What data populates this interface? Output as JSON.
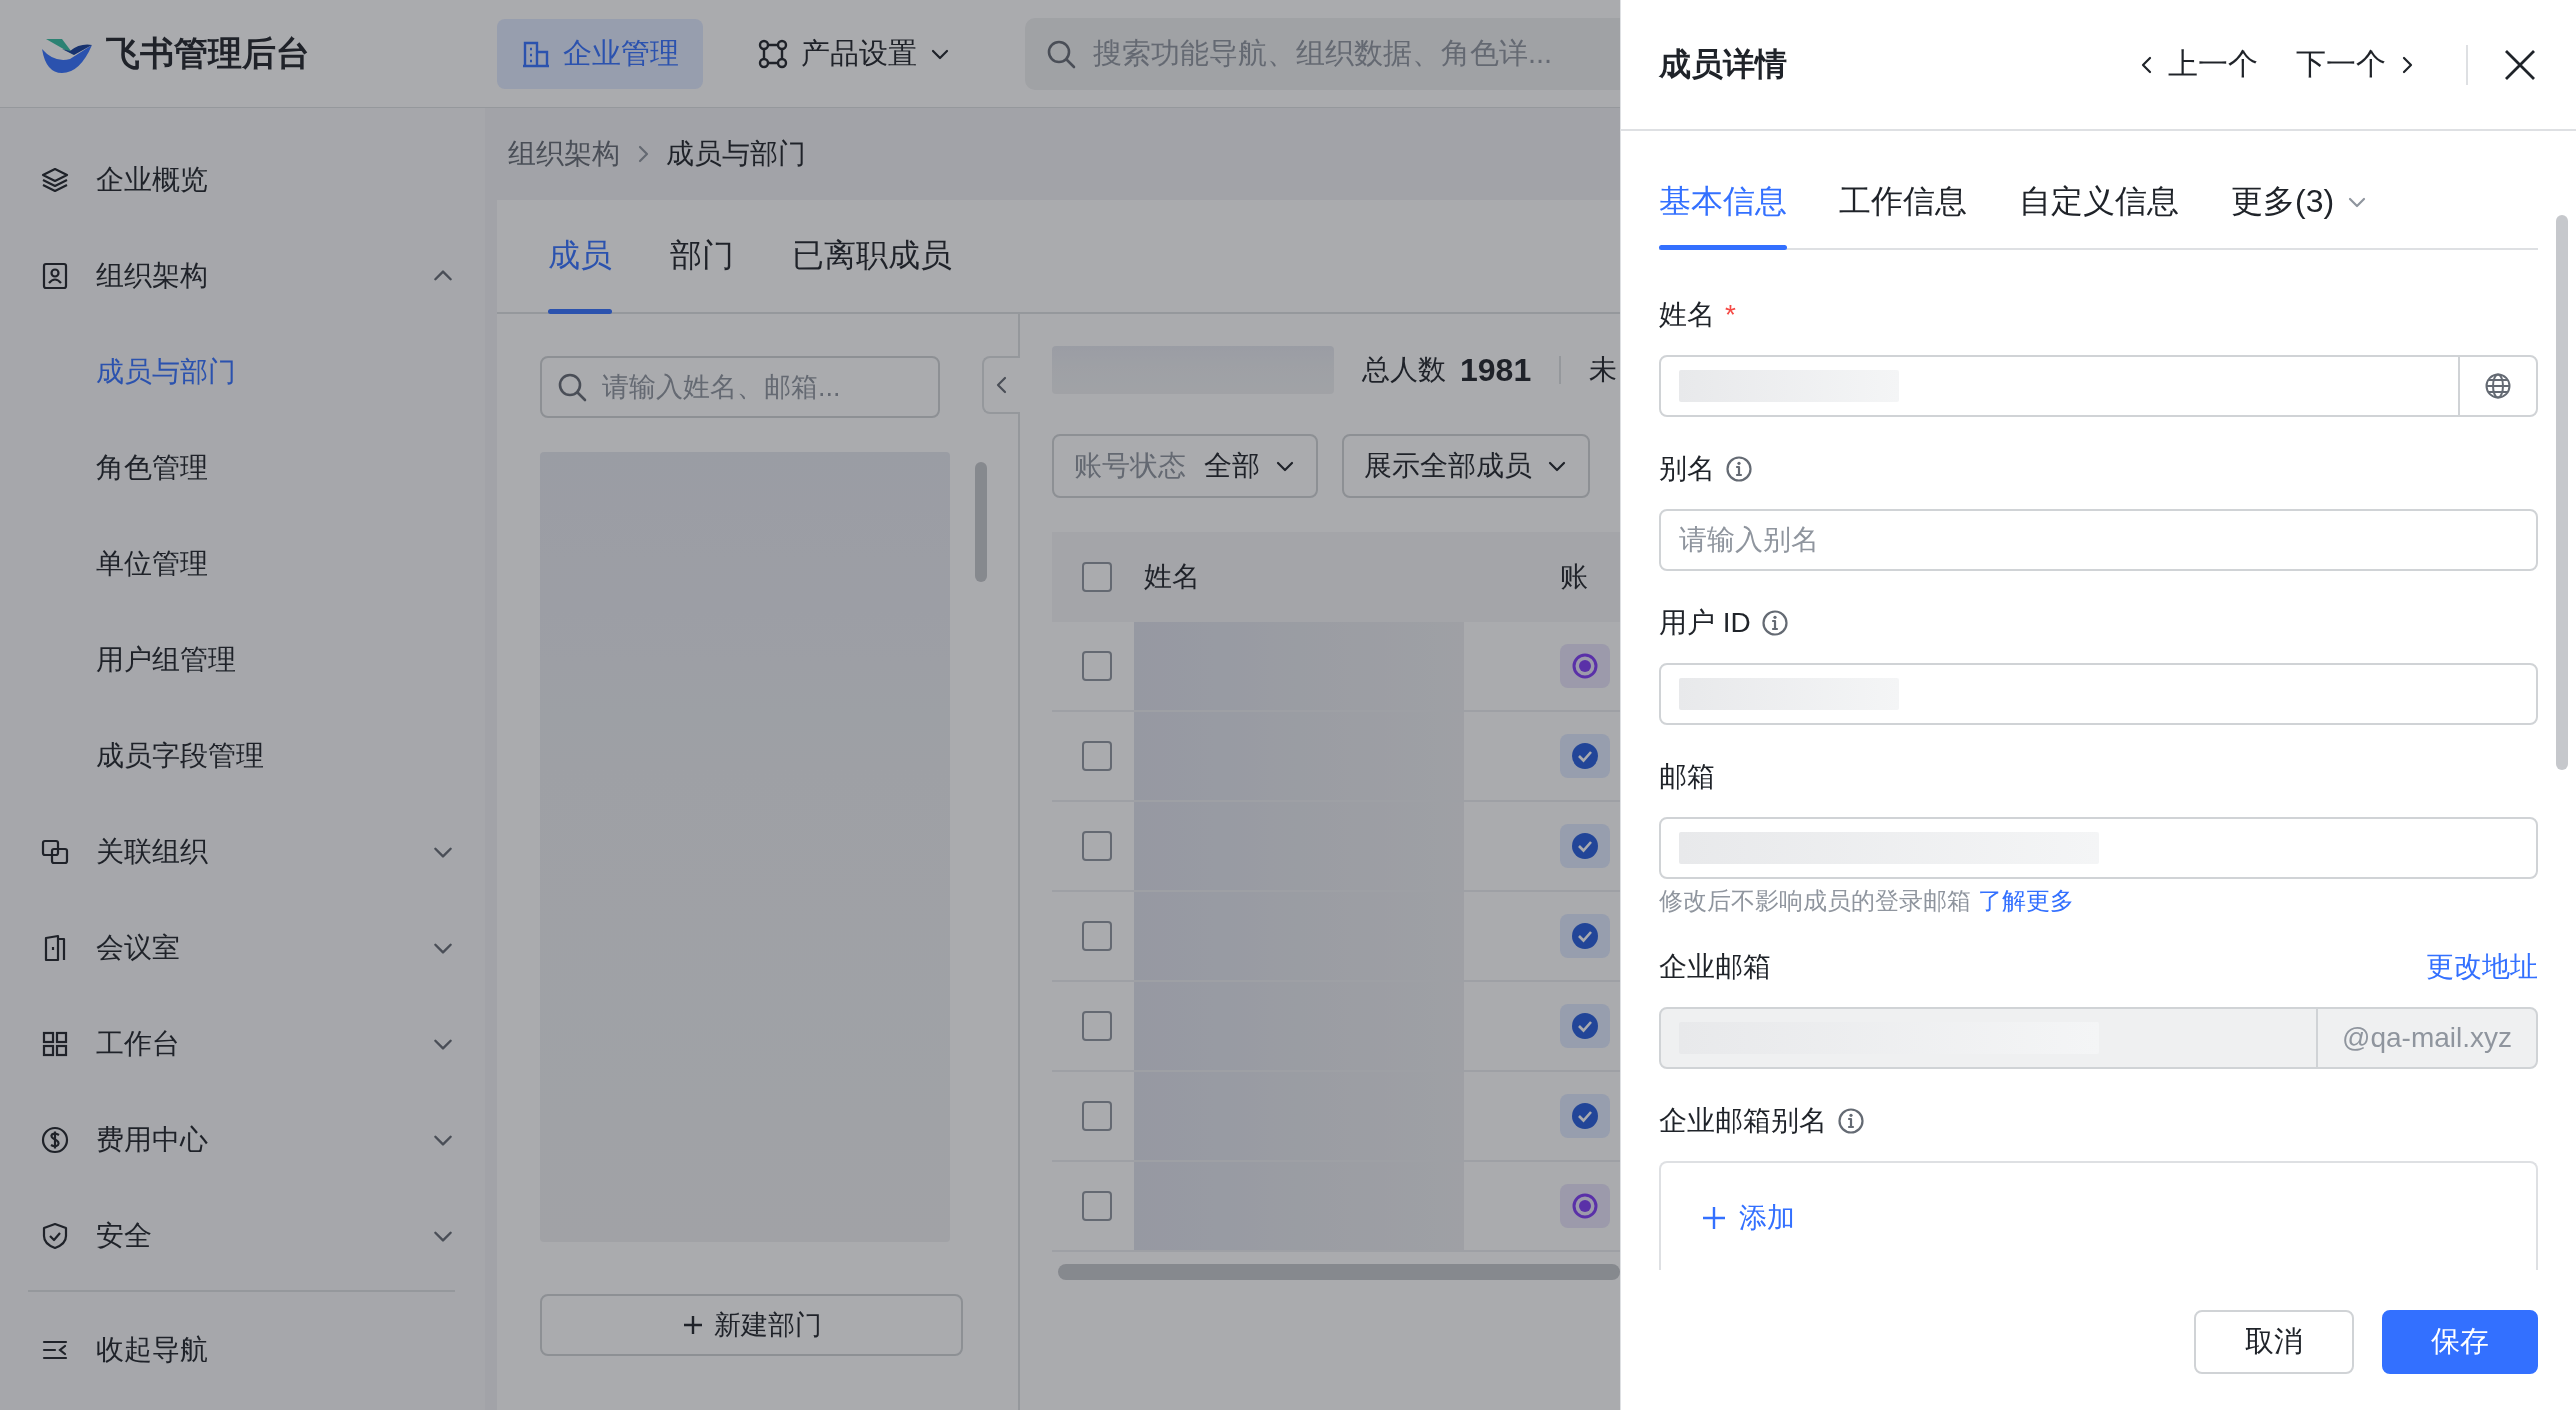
{
  "header": {
    "brand": "飞书管理后台",
    "nav": [
      {
        "label": "企业管理",
        "selected": true
      },
      {
        "label": "产品设置",
        "selected": false,
        "dropdown": true
      }
    ],
    "search": {
      "placeholder": "搜索功能导航、组织数据、角色详..."
    }
  },
  "sidebar": {
    "items": [
      {
        "kind": "link",
        "label": "企业概览",
        "selected": false
      },
      {
        "kind": "group",
        "label": "组织架构",
        "expanded": true,
        "children": [
          {
            "label": "成员与部门",
            "selected": true
          },
          {
            "label": "角色管理",
            "selected": false
          },
          {
            "label": "单位管理",
            "selected": false
          },
          {
            "label": "用户组管理",
            "selected": false
          },
          {
            "label": "成员字段管理",
            "selected": false
          }
        ]
      },
      {
        "kind": "group",
        "label": "关联组织",
        "expanded": false
      },
      {
        "kind": "group",
        "label": "会议室",
        "expanded": false
      },
      {
        "kind": "group",
        "label": "工作台",
        "expanded": false
      },
      {
        "kind": "group",
        "label": "费用中心",
        "expanded": false
      },
      {
        "kind": "group",
        "label": "安全",
        "expanded": false
      }
    ],
    "collapse": "收起导航"
  },
  "breadcrumb": [
    "组织架构",
    "成员与部门"
  ],
  "tabs": [
    {
      "label": "成员",
      "selected": true
    },
    {
      "label": "部门",
      "selected": false
    },
    {
      "label": "已离职成员",
      "selected": false
    }
  ],
  "departments": {
    "search": {
      "placeholder": "请输入姓名、邮箱..."
    },
    "new_button": "新建部门"
  },
  "members": {
    "total_label": "总人数",
    "total": "1981",
    "cut_label": "未",
    "filters": [
      {
        "label": "账号状态",
        "value": "全部"
      },
      {
        "value": "展示全部成员"
      }
    ],
    "columns": [
      "姓名",
      "账"
    ],
    "all_checked": false,
    "rows": [
      {
        "checked": false,
        "kind": "pending"
      },
      {
        "checked": false,
        "kind": "active"
      },
      {
        "checked": false,
        "kind": "active"
      },
      {
        "checked": false,
        "kind": "active"
      },
      {
        "checked": false,
        "kind": "active"
      },
      {
        "checked": false,
        "kind": "active"
      },
      {
        "checked": false,
        "kind": "pending"
      }
    ]
  },
  "drawer": {
    "title": "成员详情",
    "prev": "上一个",
    "next": "下一个",
    "tabs": [
      {
        "label": "基本信息",
        "selected": true
      },
      {
        "label": "工作信息",
        "selected": false
      },
      {
        "label": "自定义信息",
        "selected": false
      },
      {
        "label": "更多(3)",
        "selected": false,
        "dropdown": true
      }
    ],
    "fields": [
      {
        "kind": "localized",
        "label": "姓名",
        "required_mark": "*",
        "redacted": true
      },
      {
        "kind": "text",
        "label": "别名",
        "info": true,
        "placeholder": "请输入别名"
      },
      {
        "kind": "text",
        "label": "用户 ID",
        "info": true,
        "redacted": true
      },
      {
        "kind": "text",
        "label": "邮箱",
        "redacted": true,
        "help": "修改后不影响成员的登录邮箱",
        "help_link": "了解更多"
      },
      {
        "kind": "suffixed",
        "label": "企业邮箱",
        "redacted": true,
        "disabled": true,
        "action": "更改地址",
        "suffix": "@qa-mail.xyz"
      },
      {
        "kind": "list",
        "label": "企业邮箱别名",
        "info": true,
        "add": "添加"
      }
    ],
    "cancel": "取消",
    "save": "保存"
  }
}
